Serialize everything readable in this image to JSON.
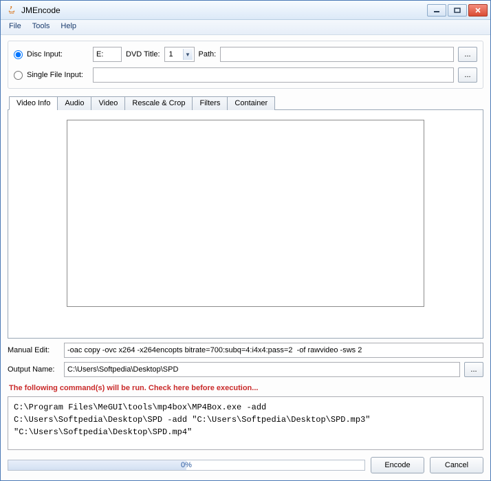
{
  "window": {
    "title": "JMEncode"
  },
  "menubar": {
    "file": "File",
    "tools": "Tools",
    "help": "Help"
  },
  "inputs": {
    "disc_radio_label": "Disc Input:",
    "drive_value": "E:",
    "dvd_title_label": "DVD Title:",
    "dvd_title_value": "1",
    "path_label": "Path:",
    "path_value": "",
    "single_radio_label": "Single File Input:",
    "single_value": "",
    "browse": "..."
  },
  "tabs": {
    "video_info": "Video Info",
    "audio": "Audio",
    "video": "Video",
    "rescale_crop": "Rescale & Crop",
    "filters": "Filters",
    "container": "Container"
  },
  "manual_edit": {
    "label": "Manual Edit:",
    "value": "-oac copy -ovc x264 -x264encopts bitrate=700:subq=4:i4x4:pass=2  -of rawvideo -sws 2"
  },
  "output_name": {
    "label": "Output Name:",
    "value": "C:\\Users\\Softpedia\\Desktop\\SPD",
    "browse": "..."
  },
  "warning": "The following command(s) will be run. Check here before execution...",
  "command_preview": "C:\\Program Files\\MeGUI\\tools\\mp4box\\MP4Box.exe -add\nC:\\Users\\Softpedia\\Desktop\\SPD -add \"C:\\Users\\Softpedia\\Desktop\\SPD.mp3\"\n\"C:\\Users\\Softpedia\\Desktop\\SPD.mp4\"",
  "progress": {
    "label": "0%"
  },
  "buttons": {
    "encode": "Encode",
    "cancel": "Cancel"
  }
}
